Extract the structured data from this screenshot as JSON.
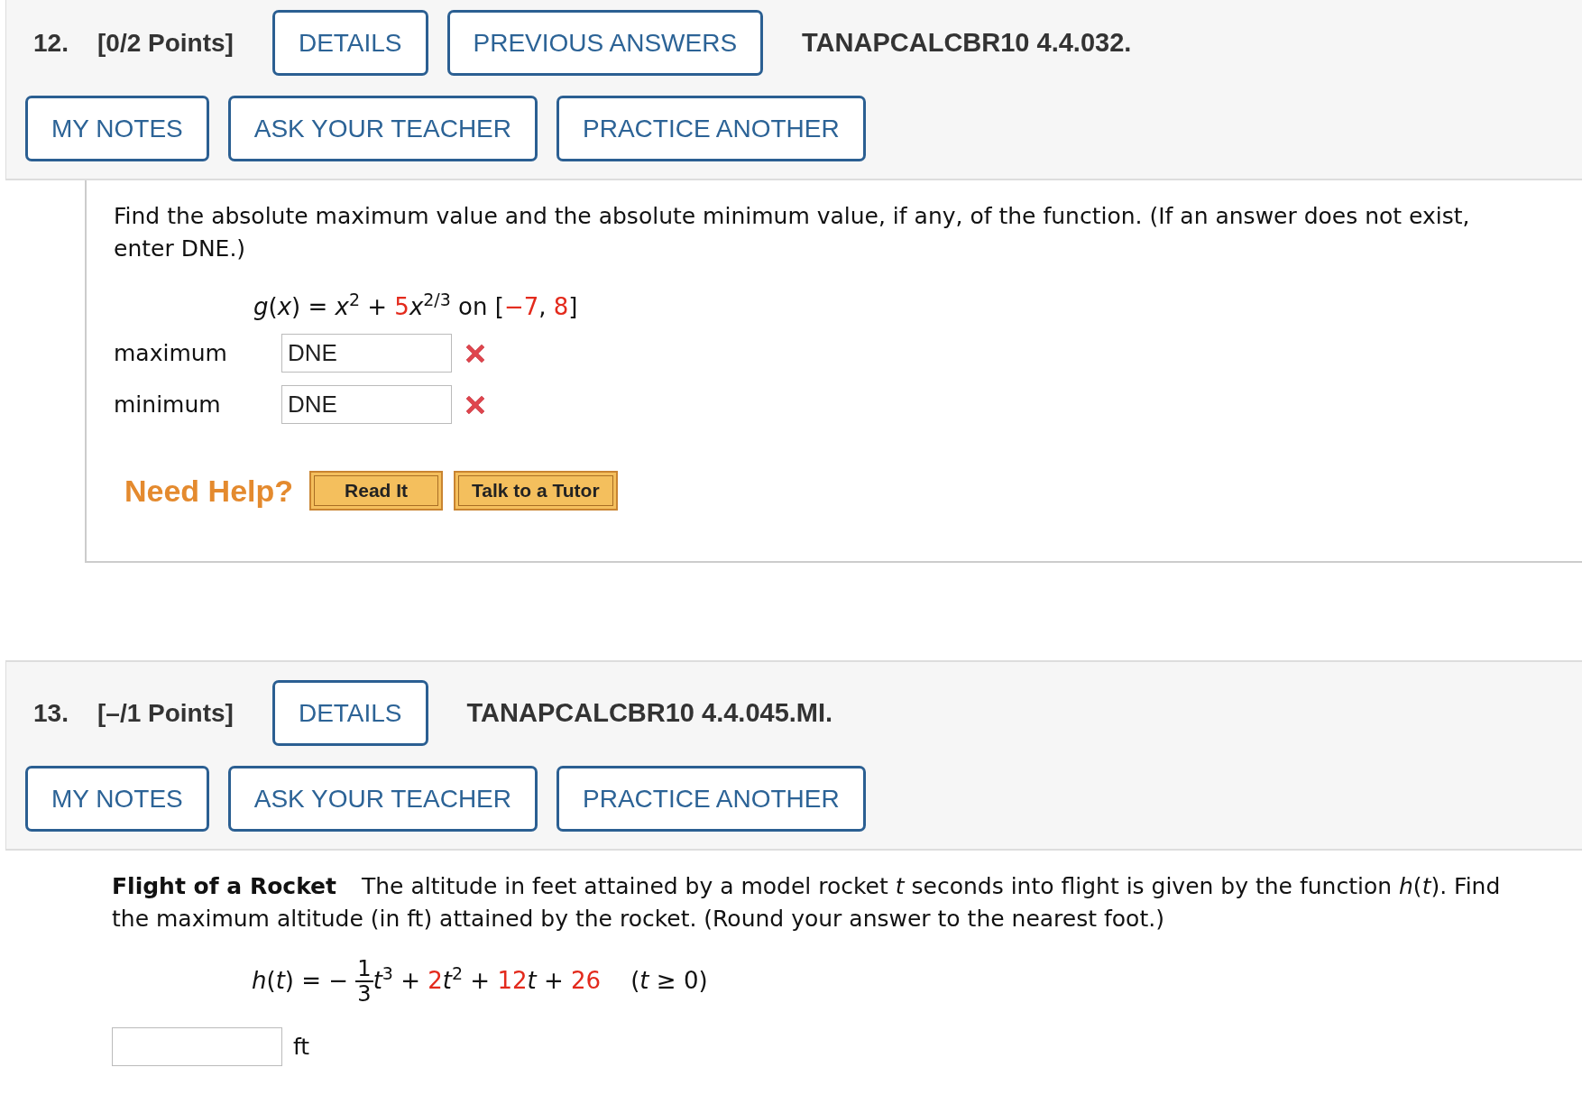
{
  "questions": [
    {
      "number": "12.",
      "points": "[0/2 Points]",
      "top_buttons": [
        "DETAILS",
        "PREVIOUS ANSWERS"
      ],
      "code": "TANAPCALCBR10 4.4.032.",
      "bottom_buttons": [
        "MY NOTES",
        "ASK YOUR TEACHER",
        "PRACTICE ANOTHER"
      ],
      "prompt": "Find the absolute maximum value and the absolute minimum value, if any, of the function. (If an answer does not exist, enter DNE.)",
      "formula": [
        {
          "kind": "var",
          "text": "g"
        },
        {
          "kind": "text",
          "text": "("
        },
        {
          "kind": "var",
          "text": "x"
        },
        {
          "kind": "text",
          "text": ") = "
        },
        {
          "kind": "var",
          "text": "x"
        },
        {
          "kind": "sup",
          "text": "2"
        },
        {
          "kind": "text",
          "text": " + "
        },
        {
          "kind": "param",
          "text": "5"
        },
        {
          "kind": "var",
          "text": "x"
        },
        {
          "kind": "sup",
          "text": "2/3"
        },
        {
          "kind": "text",
          "text": " on ["
        },
        {
          "kind": "param",
          "text": "−7"
        },
        {
          "kind": "text",
          "text": ", "
        },
        {
          "kind": "param",
          "text": "8"
        },
        {
          "kind": "text",
          "text": "]"
        }
      ],
      "answers": [
        {
          "label": "maximum",
          "value": "DNE",
          "correct": false
        },
        {
          "label": "minimum",
          "value": "DNE",
          "correct": false
        }
      ],
      "help": {
        "label": "Need Help?",
        "buttons": [
          "Read It",
          "Talk to a Tutor"
        ]
      }
    },
    {
      "number": "13.",
      "points": "[–/1 Points]",
      "top_buttons": [
        "DETAILS"
      ],
      "code": "TANAPCALCBR10 4.4.045.MI.",
      "bottom_buttons": [
        "MY NOTES",
        "ASK YOUR TEACHER",
        "PRACTICE ANOTHER"
      ],
      "title": "Flight of a Rocket",
      "prompt": "The altitude in feet attained by a model rocket *t* seconds into flight is given by the function *h*(*t*). Find the maximum altitude (in ft) attained by the rocket. (Round your answer to the nearest foot.)",
      "formula": [
        {
          "kind": "var",
          "text": "h"
        },
        {
          "kind": "text",
          "text": "("
        },
        {
          "kind": "var",
          "text": "t"
        },
        {
          "kind": "text",
          "text": ") = − "
        },
        {
          "kind": "fraction",
          "numerator": "1",
          "denominator": "3"
        },
        {
          "kind": "var",
          "text": "t"
        },
        {
          "kind": "sup",
          "text": "3"
        },
        {
          "kind": "text",
          "text": " + "
        },
        {
          "kind": "param",
          "text": "2"
        },
        {
          "kind": "var",
          "text": "t"
        },
        {
          "kind": "sup",
          "text": "2"
        },
        {
          "kind": "text",
          "text": " + "
        },
        {
          "kind": "param",
          "text": "12"
        },
        {
          "kind": "var",
          "text": "t"
        },
        {
          "kind": "text",
          "text": " + "
        },
        {
          "kind": "param",
          "text": "26"
        },
        {
          "kind": "text",
          "text": "    ("
        },
        {
          "kind": "var",
          "text": "t"
        },
        {
          "kind": "text",
          "text": " ≥ 0)"
        }
      ],
      "answers": [
        {
          "unit": "ft"
        }
      ]
    }
  ]
}
